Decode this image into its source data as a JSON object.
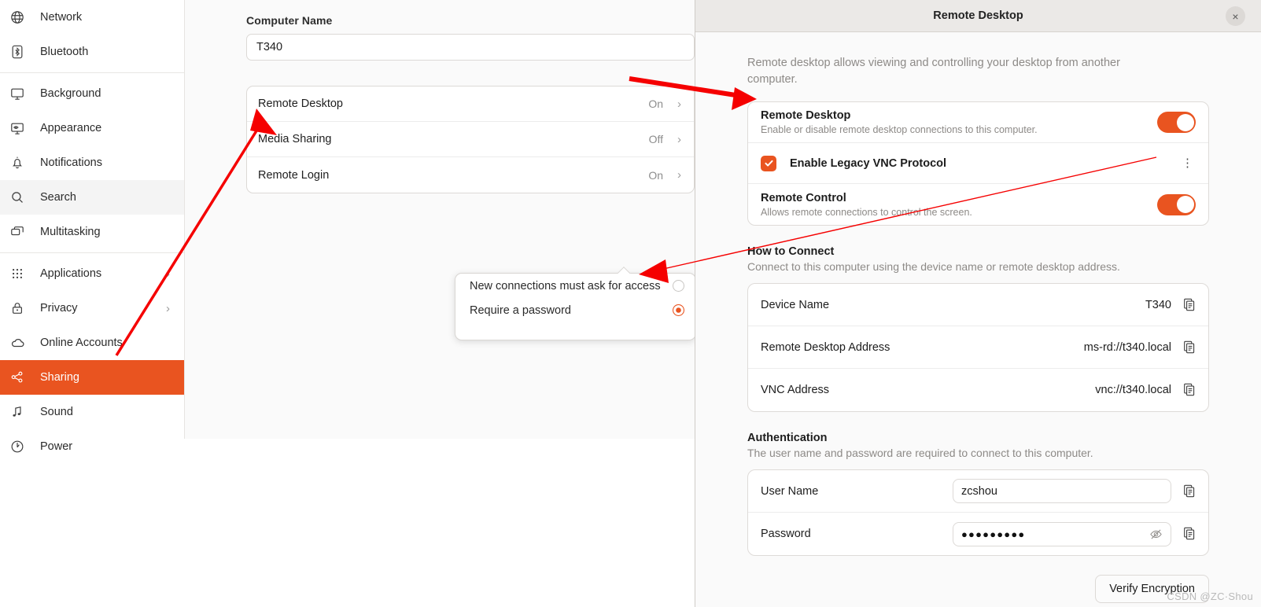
{
  "sidebar": {
    "items": [
      {
        "label": "Network",
        "icon": "globe-icon",
        "chevron": "",
        "state": "normal"
      },
      {
        "label": "Bluetooth",
        "icon": "bluetooth-icon",
        "chevron": "",
        "state": "normal"
      },
      {
        "label": "Background",
        "icon": "monitor-icon",
        "chevron": "",
        "state": "normal"
      },
      {
        "label": "Appearance",
        "icon": "appearance-icon",
        "chevron": "",
        "state": "normal"
      },
      {
        "label": "Notifications",
        "icon": "bell-icon",
        "chevron": "",
        "state": "normal"
      },
      {
        "label": "Search",
        "icon": "search-icon",
        "chevron": "",
        "state": "hover"
      },
      {
        "label": "Multitasking",
        "icon": "windows-icon",
        "chevron": "",
        "state": "normal"
      },
      {
        "label": "Applications",
        "icon": "grid-icon",
        "chevron": "›",
        "state": "normal"
      },
      {
        "label": "Privacy",
        "icon": "lock-icon",
        "chevron": "›",
        "state": "normal"
      },
      {
        "label": "Online Accounts",
        "icon": "cloud-icon",
        "chevron": "",
        "state": "normal"
      },
      {
        "label": "Sharing",
        "icon": "share-icon",
        "chevron": "",
        "state": "active"
      },
      {
        "label": "Sound",
        "icon": "music-note-icon",
        "chevron": "",
        "state": "normal"
      },
      {
        "label": "Power",
        "icon": "power-icon",
        "chevron": "",
        "state": "normal"
      }
    ]
  },
  "content": {
    "computer_name_label": "Computer Name",
    "computer_name_value": "T340",
    "rows": [
      {
        "label": "Remote Desktop",
        "state": "On",
        "chevron": "›"
      },
      {
        "label": "Media Sharing",
        "state": "Off",
        "chevron": "›"
      },
      {
        "label": "Remote Login",
        "state": "On",
        "chevron": "›"
      }
    ]
  },
  "popover": {
    "options": [
      {
        "label": "New connections must ask for access",
        "selected": false
      },
      {
        "label": "Require a password",
        "selected": true
      }
    ]
  },
  "dialog": {
    "title": "Remote Desktop",
    "close_label": "×",
    "intro": "Remote desktop allows viewing and controlling your desktop from another computer.",
    "settings": {
      "remote_desktop": {
        "title": "Remote Desktop",
        "subtitle": "Enable or disable remote desktop connections to this computer.",
        "toggle": "on"
      },
      "legacy_vnc": {
        "label": "Enable Legacy VNC Protocol",
        "checked": true,
        "menu_icon": "kebab-menu-icon"
      },
      "remote_control": {
        "title": "Remote Control",
        "subtitle": "Allows remote connections to control the screen.",
        "toggle": "on"
      }
    },
    "how_to_connect": {
      "heading": "How to Connect",
      "description": "Connect to this computer using the device name or remote desktop address.",
      "rows": [
        {
          "key": "Device Name",
          "value": "T340"
        },
        {
          "key": "Remote Desktop Address",
          "value": "ms-rd://t340.local"
        },
        {
          "key": "VNC Address",
          "value": "vnc://t340.local"
        }
      ]
    },
    "authentication": {
      "heading": "Authentication",
      "description": "The user name and password are required to connect to this computer.",
      "user_name_label": "User Name",
      "user_name_value": "zcshou",
      "password_label": "Password",
      "password_value": "●●●●●●●●●"
    },
    "verify_button": "Verify Encryption"
  },
  "watermark": "CSDN @ZC·Shou",
  "colors": {
    "accent": "#e95420",
    "window_bg": "#fafafa",
    "card_bg": "#ffffff",
    "annotation": "#f50000"
  }
}
